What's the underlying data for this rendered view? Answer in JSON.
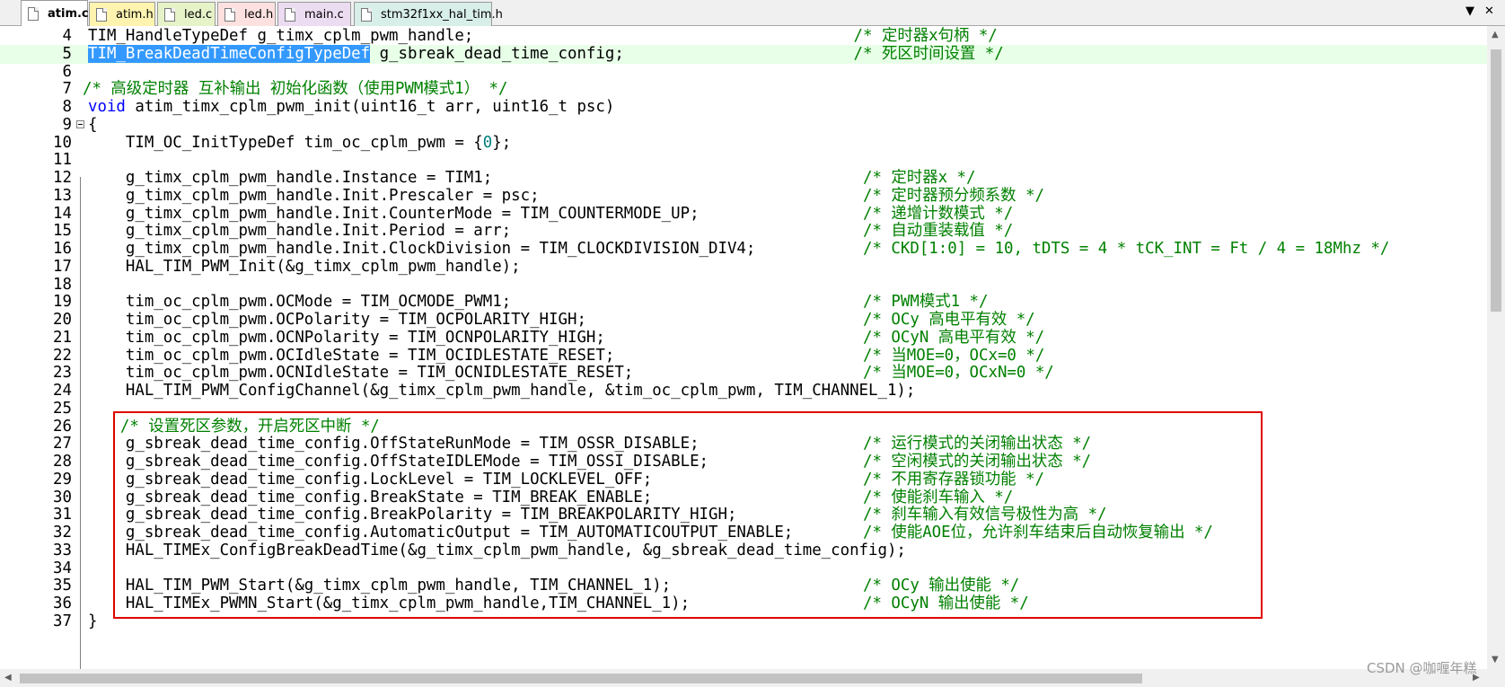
{
  "tabs": [
    {
      "label": "atim.c",
      "color": "#ffffff",
      "active": true
    },
    {
      "label": "atim.h",
      "color": "#fff3b0",
      "active": false
    },
    {
      "label": "led.c",
      "color": "#e6f2c8",
      "active": false
    },
    {
      "label": "led.h",
      "color": "#fde0e0",
      "active": false
    },
    {
      "label": "main.c",
      "color": "#ecdcf2",
      "active": false
    },
    {
      "label": "stm32f1xx_hal_tim.h",
      "color": "#d8eee8",
      "active": false
    }
  ],
  "tab_controls": {
    "menu_icon": "▼",
    "close_icon": "✕"
  },
  "lines": [
    {
      "n": "4",
      "code": "TIM_HandleTypeDef g_timx_cplm_pwm_handle;",
      "comment": "/* 定时器x句柄 */",
      "cc": 82
    },
    {
      "n": "5",
      "sel": "TIM_BreakDeadTimeConfigTypeDef",
      "code": " g_sbreak_dead_time_config;",
      "comment": "/* 死区时间设置 */",
      "cc": 82
    },
    {
      "n": "6",
      "code": ""
    },
    {
      "n": "7",
      "comment": "/* 高级定时器 互补输出 初始化函数（使用PWM模式1） */",
      "cc": 0
    },
    {
      "n": "8",
      "kw": "void",
      "code": " atim_timx_cplm_pwm_init(uint16_t arr, uint16_t psc)"
    },
    {
      "n": "9",
      "code": "{"
    },
    {
      "n": "10",
      "code": "    TIM_OC_InitTypeDef tim_oc_cplm_pwm = {",
      "num": "0",
      "tail": "};"
    },
    {
      "n": "11",
      "code": ""
    },
    {
      "n": "12",
      "code": "    g_timx_cplm_pwm_handle.Instance = TIM1;",
      "comment": "/* 定时器x */",
      "cc": 83
    },
    {
      "n": "13",
      "code": "    g_timx_cplm_pwm_handle.Init.Prescaler = psc;",
      "comment": "/* 定时器预分频系数 */",
      "cc": 83
    },
    {
      "n": "14",
      "code": "    g_timx_cplm_pwm_handle.Init.CounterMode = TIM_COUNTERMODE_UP;",
      "comment": "/* 递增计数模式 */",
      "cc": 83
    },
    {
      "n": "15",
      "code": "    g_timx_cplm_pwm_handle.Init.Period = arr;",
      "comment": "/* 自动重装载值 */",
      "cc": 83
    },
    {
      "n": "16",
      "code": "    g_timx_cplm_pwm_handle.Init.ClockDivision = TIM_CLOCKDIVISION_DIV4;",
      "comment": "/* CKD[1:0] = 10, tDTS = 4 * tCK_INT = Ft / 4 = 18Mhz */",
      "cc": 83
    },
    {
      "n": "17",
      "code": "    HAL_TIM_PWM_Init(&g_timx_cplm_pwm_handle);"
    },
    {
      "n": "18",
      "code": ""
    },
    {
      "n": "19",
      "code": "    tim_oc_cplm_pwm.OCMode = TIM_OCMODE_PWM1;",
      "comment": "/* PWM模式1 */",
      "cc": 83
    },
    {
      "n": "20",
      "code": "    tim_oc_cplm_pwm.OCPolarity = TIM_OCPOLARITY_HIGH;",
      "comment": "/* OCy 高电平有效 */",
      "cc": 83
    },
    {
      "n": "21",
      "code": "    tim_oc_cplm_pwm.OCNPolarity = TIM_OCNPOLARITY_HIGH;",
      "comment": "/* OCyN 高电平有效 */",
      "cc": 83
    },
    {
      "n": "22",
      "code": "    tim_oc_cplm_pwm.OCIdleState = TIM_OCIDLESTATE_RESET;",
      "comment": "/* 当MOE=0，OCx=0 */",
      "cc": 83
    },
    {
      "n": "23",
      "code": "    tim_oc_cplm_pwm.OCNIdleState = TIM_OCNIDLESTATE_RESET;",
      "comment": "/* 当MOE=0，OCxN=0 */",
      "cc": 83
    },
    {
      "n": "24",
      "code": "    HAL_TIM_PWM_ConfigChannel(&g_timx_cplm_pwm_handle, &tim_oc_cplm_pwm, TIM_CHANNEL_1);"
    },
    {
      "n": "25",
      "code": ""
    },
    {
      "n": "26",
      "comment": "/* 设置死区参数，开启死区中断 */",
      "cc": 4
    },
    {
      "n": "27",
      "code": "    g_sbreak_dead_time_config.OffStateRunMode = TIM_OSSR_DISABLE;",
      "comment": "/* 运行模式的关闭输出状态 */",
      "cc": 83
    },
    {
      "n": "28",
      "code": "    g_sbreak_dead_time_config.OffStateIDLEMode = TIM_OSSI_DISABLE;",
      "comment": "/* 空闲模式的关闭输出状态 */",
      "cc": 83
    },
    {
      "n": "29",
      "code": "    g_sbreak_dead_time_config.LockLevel = TIM_LOCKLEVEL_OFF;",
      "comment": "/* 不用寄存器锁功能 */",
      "cc": 83
    },
    {
      "n": "30",
      "code": "    g_sbreak_dead_time_config.BreakState = TIM_BREAK_ENABLE;",
      "comment": "/* 使能刹车输入 */",
      "cc": 83
    },
    {
      "n": "31",
      "code": "    g_sbreak_dead_time_config.BreakPolarity = TIM_BREAKPOLARITY_HIGH;",
      "comment": "/* 刹车输入有效信号极性为高 */",
      "cc": 83
    },
    {
      "n": "32",
      "code": "    g_sbreak_dead_time_config.AutomaticOutput = TIM_AUTOMATICOUTPUT_ENABLE;",
      "comment": "/* 使能AOE位，允许刹车结束后自动恢复输出 */",
      "cc": 83
    },
    {
      "n": "33",
      "code": "    HAL_TIMEx_ConfigBreakDeadTime(&g_timx_cplm_pwm_handle, &g_sbreak_dead_time_config);"
    },
    {
      "n": "34",
      "code": ""
    },
    {
      "n": "35",
      "code": "    HAL_TIM_PWM_Start(&g_timx_cplm_pwm_handle, TIM_CHANNEL_1);",
      "comment": "/* OCy 输出使能 */",
      "cc": 83
    },
    {
      "n": "36",
      "code": "    HAL_TIMEx_PWMN_Start(&g_timx_cplm_pwm_handle,TIM_CHANNEL_1);",
      "comment": "/* OCyN 输出使能 */",
      "cc": 83
    },
    {
      "n": "37",
      "code": "}"
    }
  ],
  "watermark": "CSDN @咖喱年糕",
  "colors": {
    "comment": "#008000",
    "keyword": "#0000ff",
    "number": "#008080",
    "selection": "#3399ff",
    "current_line": "#e8ffe8",
    "box": "#e00000"
  }
}
